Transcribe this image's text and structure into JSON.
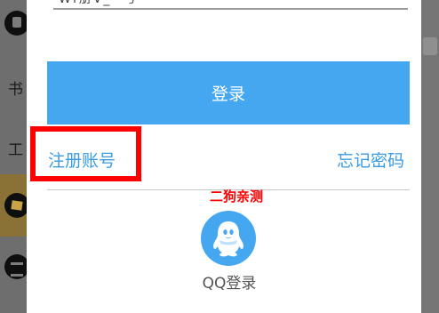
{
  "background": {
    "side_labels": [
      "书",
      "工"
    ]
  },
  "dialog": {
    "account_value": "Wf册V_^号",
    "login_button": "登录",
    "register_link": "注册账号",
    "forgot_link": "忘记密码",
    "watermark": "二狗亲测",
    "qq_label": "QQ登录"
  },
  "colors": {
    "accent": "#46a7f1",
    "link": "#3a9be0",
    "highlight": "#ff0000"
  },
  "icons": [
    "qq-penguin-icon",
    "app-icon",
    "crown-icon",
    "layers-icon"
  ]
}
